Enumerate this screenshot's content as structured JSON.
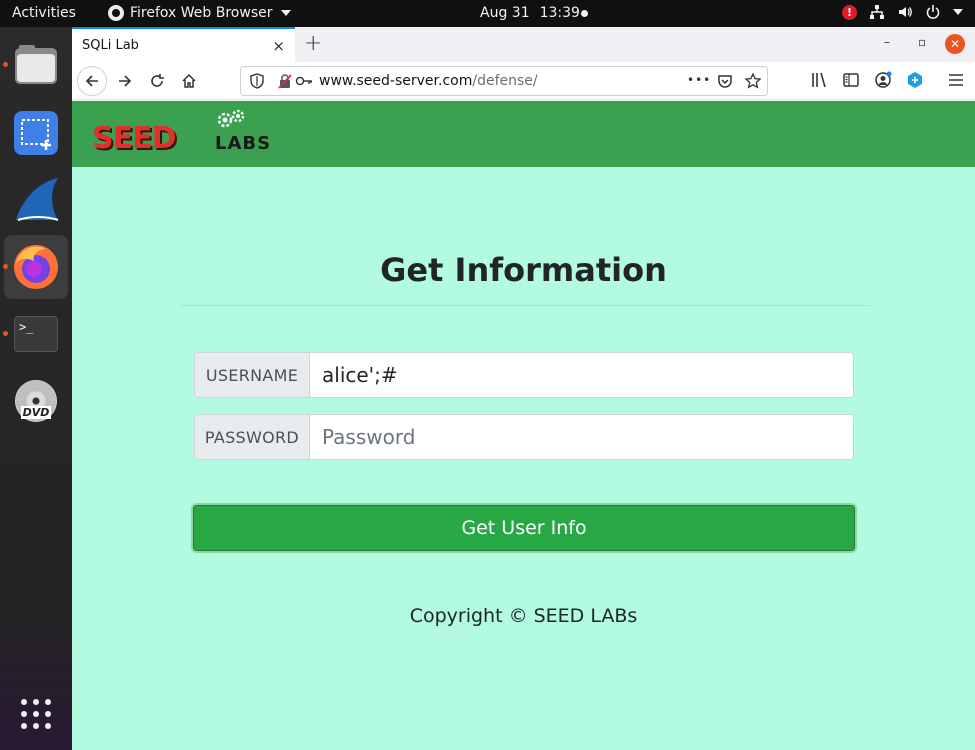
{
  "topbar": {
    "activities": "Activities",
    "app_name": "Firefox Web Browser",
    "date": "Aug 31",
    "time": "13:39",
    "alert": "!"
  },
  "dock": {
    "items": [
      "files-icon",
      "screenshot-icon",
      "wireshark-icon",
      "firefox-icon",
      "terminal-icon",
      "dvd-icon",
      "app-grid-icon"
    ],
    "terminal_prompt": ">_",
    "dvd_label": "DVD"
  },
  "browser": {
    "tab_title": "SQLi Lab",
    "tab_close": "×",
    "new_tab": "+",
    "url_host": "www.seed-server.com",
    "url_path": "/defense/",
    "url_more": "•••",
    "win_minimize": "–",
    "win_maximize": "▫",
    "win_close": "✕"
  },
  "page": {
    "logo_main": "SEED",
    "logo_sub": "LABS",
    "title": "Get Information",
    "username_label": "USERNAME",
    "username_value": "alice';#",
    "password_label": "PASSWORD",
    "password_placeholder": "Password",
    "submit_label": "Get User Info",
    "copyright": "Copyright © SEED LABs"
  },
  "colors": {
    "header_green": "#3ba151",
    "page_bg": "#b2fae0",
    "button_green": "#28a745",
    "accent": "#e95420"
  }
}
